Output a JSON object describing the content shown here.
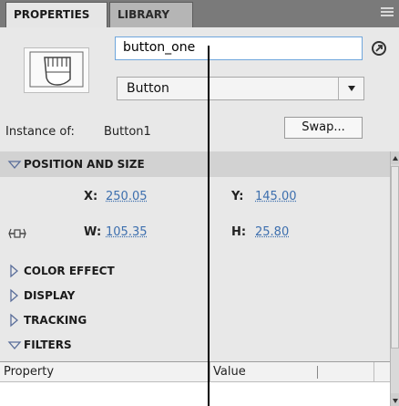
{
  "tabs": [
    {
      "label": "PROPERTIES",
      "active": true
    },
    {
      "label": "LIBRARY",
      "active": false
    }
  ],
  "instance": {
    "name_value": "button_one",
    "type_value": "Button",
    "instance_of_label": "Instance of:",
    "instance_of_value": "Button1",
    "swap_label": "Swap..."
  },
  "sections": {
    "position_and_size": "POSITION AND SIZE",
    "color_effect": "COLOR EFFECT",
    "display": "DISPLAY",
    "tracking": "TRACKING",
    "filters": "FILTERS"
  },
  "position": {
    "x_label": "X:",
    "x_value": "250.05",
    "y_label": "Y:",
    "y_value": "145.00",
    "w_label": "W:",
    "w_value": "105.35",
    "h_label": "H:",
    "h_value": "25.80"
  },
  "filter_table": {
    "headers": [
      "Property",
      "Value"
    ]
  },
  "colors": {
    "value_link": "#3d6fae",
    "input_focus_border": "#6fa6dc",
    "tabbar_bg": "#7a7a7a"
  },
  "icons": [
    "button-symbol-icon",
    "link-icon",
    "dropdown-arrow-icon",
    "lock-proportions-icon",
    "collapse-triangle-icon",
    "expand-triangle-icon",
    "panel-menu-icon"
  ]
}
